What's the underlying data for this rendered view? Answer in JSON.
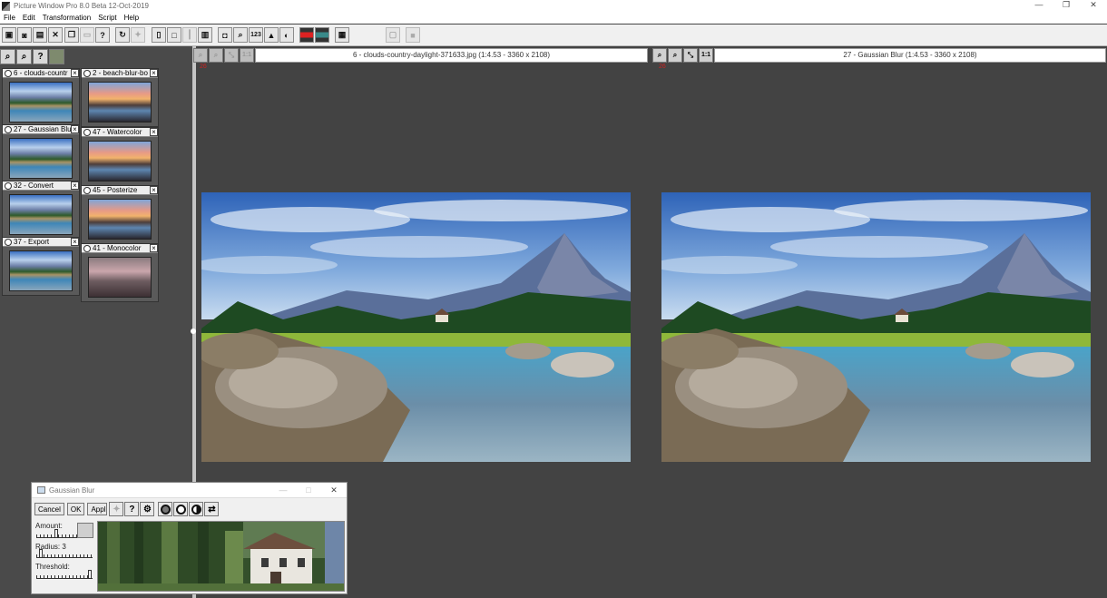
{
  "app": {
    "title": "Picture Window Pro 8.0 Beta 12-Oct-2019",
    "window_controls": {
      "minimize": "—",
      "maximize": "❐",
      "close": "✕"
    }
  },
  "menu": [
    "File",
    "Edit",
    "Transformation",
    "Script",
    "Help"
  ],
  "toolbar": {
    "icons": [
      "new-window-icon",
      "camera-icon",
      "print-icon",
      "close-icon",
      "copy-icon",
      "clipboard-icon",
      "help-icon",
      "refresh-icon",
      "pin-icon",
      "single-pane-icon",
      "blank-pane-icon",
      "split-pane-icon",
      "dual-pane-icon",
      "mouse-icon",
      "zoom-icon",
      "number-icon",
      "histogram-icon",
      "palette-icon",
      "color-bar-icon",
      "grayscale-bar-icon",
      "grid-icon",
      "screen-icon",
      "stamp-icon"
    ],
    "number_label": "123"
  },
  "left_panel": {
    "tool_icons": [
      "zoom-in-icon",
      "zoom-out-icon",
      "help-icon",
      "thumbnail-icon"
    ],
    "tool_glyphs": [
      "⌕",
      "⌕",
      "?",
      ""
    ],
    "thumbnails": [
      {
        "label": "6 - clouds-countr",
        "style": "lake"
      },
      {
        "label": "2 - beach-blur-bo",
        "style": "sunset"
      },
      {
        "label": "27 - Gaussian Blu",
        "style": "lake"
      },
      {
        "label": "47 - Watercolor",
        "style": "sunset"
      },
      {
        "label": "32 - Convert",
        "style": "lake"
      },
      {
        "label": "45 - Posterize",
        "style": "sunset"
      },
      {
        "label": "37 - Export",
        "style": "lake"
      },
      {
        "label": "41 - Monocolor",
        "style": "mono"
      }
    ]
  },
  "left_pane": {
    "title": "6 - clouds-country-daylight-371633.jpg (1:4.53 - 3360 x 2108)",
    "buttons": [
      "⌕",
      "⌕",
      "⤡",
      "1:1"
    ],
    "mark": "26"
  },
  "right_pane": {
    "title": "27 - Gaussian Blur (1:4.53 - 3360 x 2108)",
    "buttons": [
      "⌕",
      "⌕",
      "⤡",
      "1:1"
    ],
    "mark": "26"
  },
  "dialog": {
    "title": "Gaussian Blur",
    "buttons": {
      "cancel": "Cancel",
      "ok": "OK",
      "apply": "Appl"
    },
    "icon_glyphs": {
      "help": "?",
      "settings": "⚙",
      "swap": "⇄"
    },
    "amount_label": "Amount:",
    "radius_label": "Radius: 3",
    "threshold_label": "Threshold:",
    "amount_value": 0.35,
    "radius_value": 0.05,
    "threshold_value": 0.98
  },
  "colors": {
    "canvas": "#434343",
    "panel": "#4a4a4a",
    "splitter": "#c4c4c4",
    "mark": "#cc2222"
  }
}
